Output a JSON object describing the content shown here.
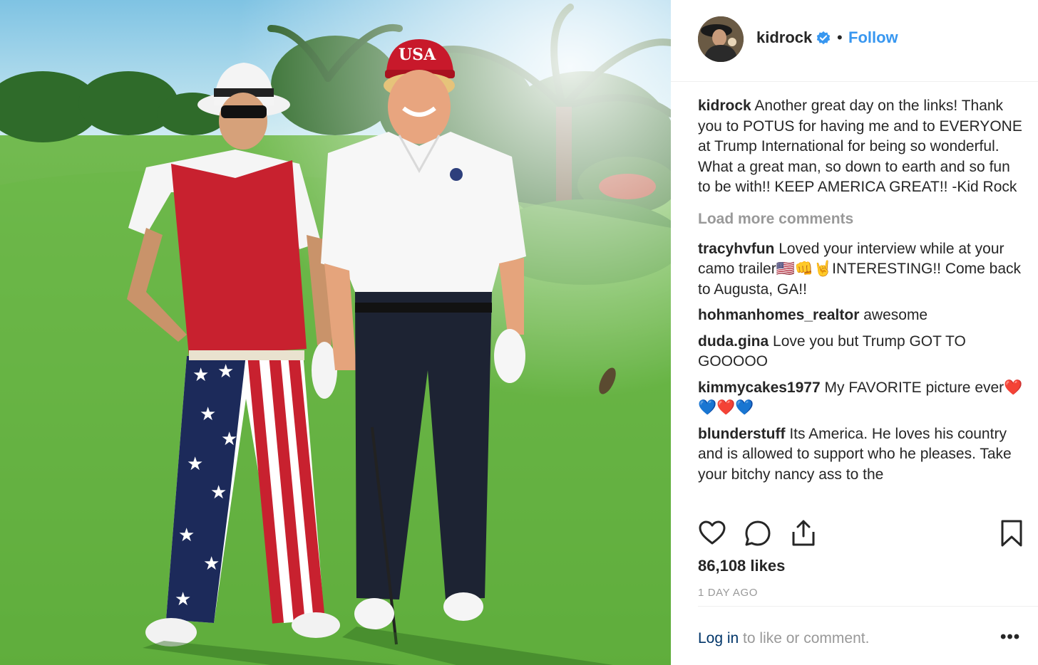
{
  "post": {
    "username": "kidrock",
    "separator": "•",
    "follow_label": "Follow",
    "caption": {
      "author": "kidrock",
      "text": "Another great day on the links! Thank you to POTUS for having me and to EVERYONE at Trump International for being so wonderful. What a great man, so down to earth and so fun to be with!! KEEP AMERICA GREAT!! -Kid Rock"
    },
    "load_more_label": "Load more comments",
    "comments": [
      {
        "author": "tracyhvfun",
        "text": "Loved your interview while at your camo trailer🇺🇸👊🤘INTERESTING!! Come back to Augusta, GA!!"
      },
      {
        "author": "hohmanhomes_realtor",
        "text": "awesome"
      },
      {
        "author": "duda.gina",
        "text": "Love you but Trump GOT TO GOOOOO"
      },
      {
        "author": "kimmycakes1977",
        "text": "My FAVORITE picture ever❤️💙❤️💙"
      },
      {
        "author": "blunderstuff",
        "text": "Its America. He loves his country and is allowed to support who he pleases. Take your bitchy nancy ass to the"
      }
    ],
    "likes": "86,108 likes",
    "timestamp": "1 DAY AGO",
    "login": {
      "link": "Log in",
      "rest": " to like or comment."
    },
    "more_label": "•••",
    "photo": {
      "hat_text": "USA"
    },
    "icons": [
      "heart-icon",
      "comment-icon",
      "share-icon",
      "bookmark-icon",
      "verified-badge-icon",
      "more-options-icon"
    ],
    "colors": {
      "accent": "#3897f0",
      "link_dark": "#003569",
      "muted": "#999999",
      "text": "#262626"
    }
  }
}
